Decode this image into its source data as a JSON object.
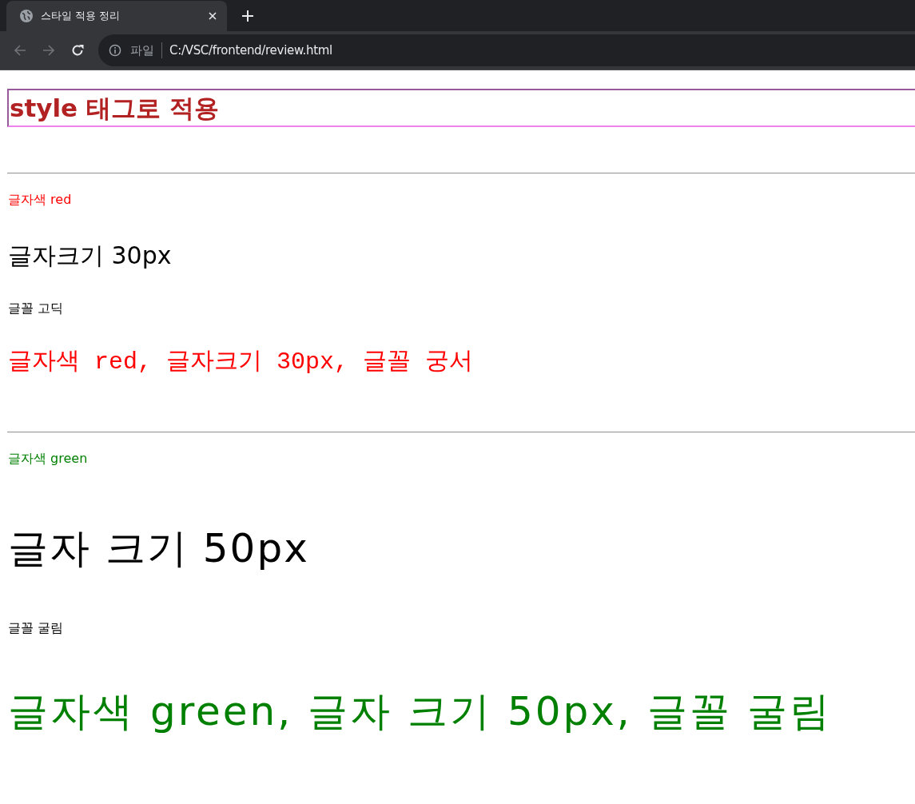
{
  "browser": {
    "tabs": [
      {
        "title": "스타일 적용 정리",
        "selected": true
      }
    ],
    "nav_buttons": [
      {
        "kind": "back",
        "disabled": true
      },
      {
        "kind": "forward",
        "disabled": true
      },
      {
        "kind": "reload",
        "disabled": false
      }
    ],
    "address_bar": {
      "scheme_label": "파일",
      "value": "C:/VSC/frontend/review.html"
    }
  },
  "page": {
    "heading": "style 태그로 적용",
    "sections": [
      {
        "paragraphs": [
          {
            "text": "글자색 red",
            "kind": "body",
            "color": "#ff0000"
          },
          {
            "text": "글자크기 30px",
            "kind": "large",
            "color": "#000000"
          },
          {
            "text": "글꼴 고딕",
            "kind": "body",
            "color": "#000000"
          },
          {
            "text": "글자색 red, 글자크기 30px, 글꼴 궁서",
            "kind": "display",
            "color": "#ff0000"
          }
        ]
      },
      {
        "paragraphs": [
          {
            "text": "글자색 green",
            "kind": "body",
            "color": "#008000"
          },
          {
            "text": "글자 크기 50px",
            "kind": "huge",
            "color": "#000000"
          },
          {
            "text": "글꼴 굴림",
            "kind": "body",
            "color": "#000000"
          },
          {
            "text": "글자색 green, 글자 크기 50px, 글꼴 굴림",
            "kind": "banner",
            "color": "#008000"
          }
        ]
      }
    ]
  }
}
